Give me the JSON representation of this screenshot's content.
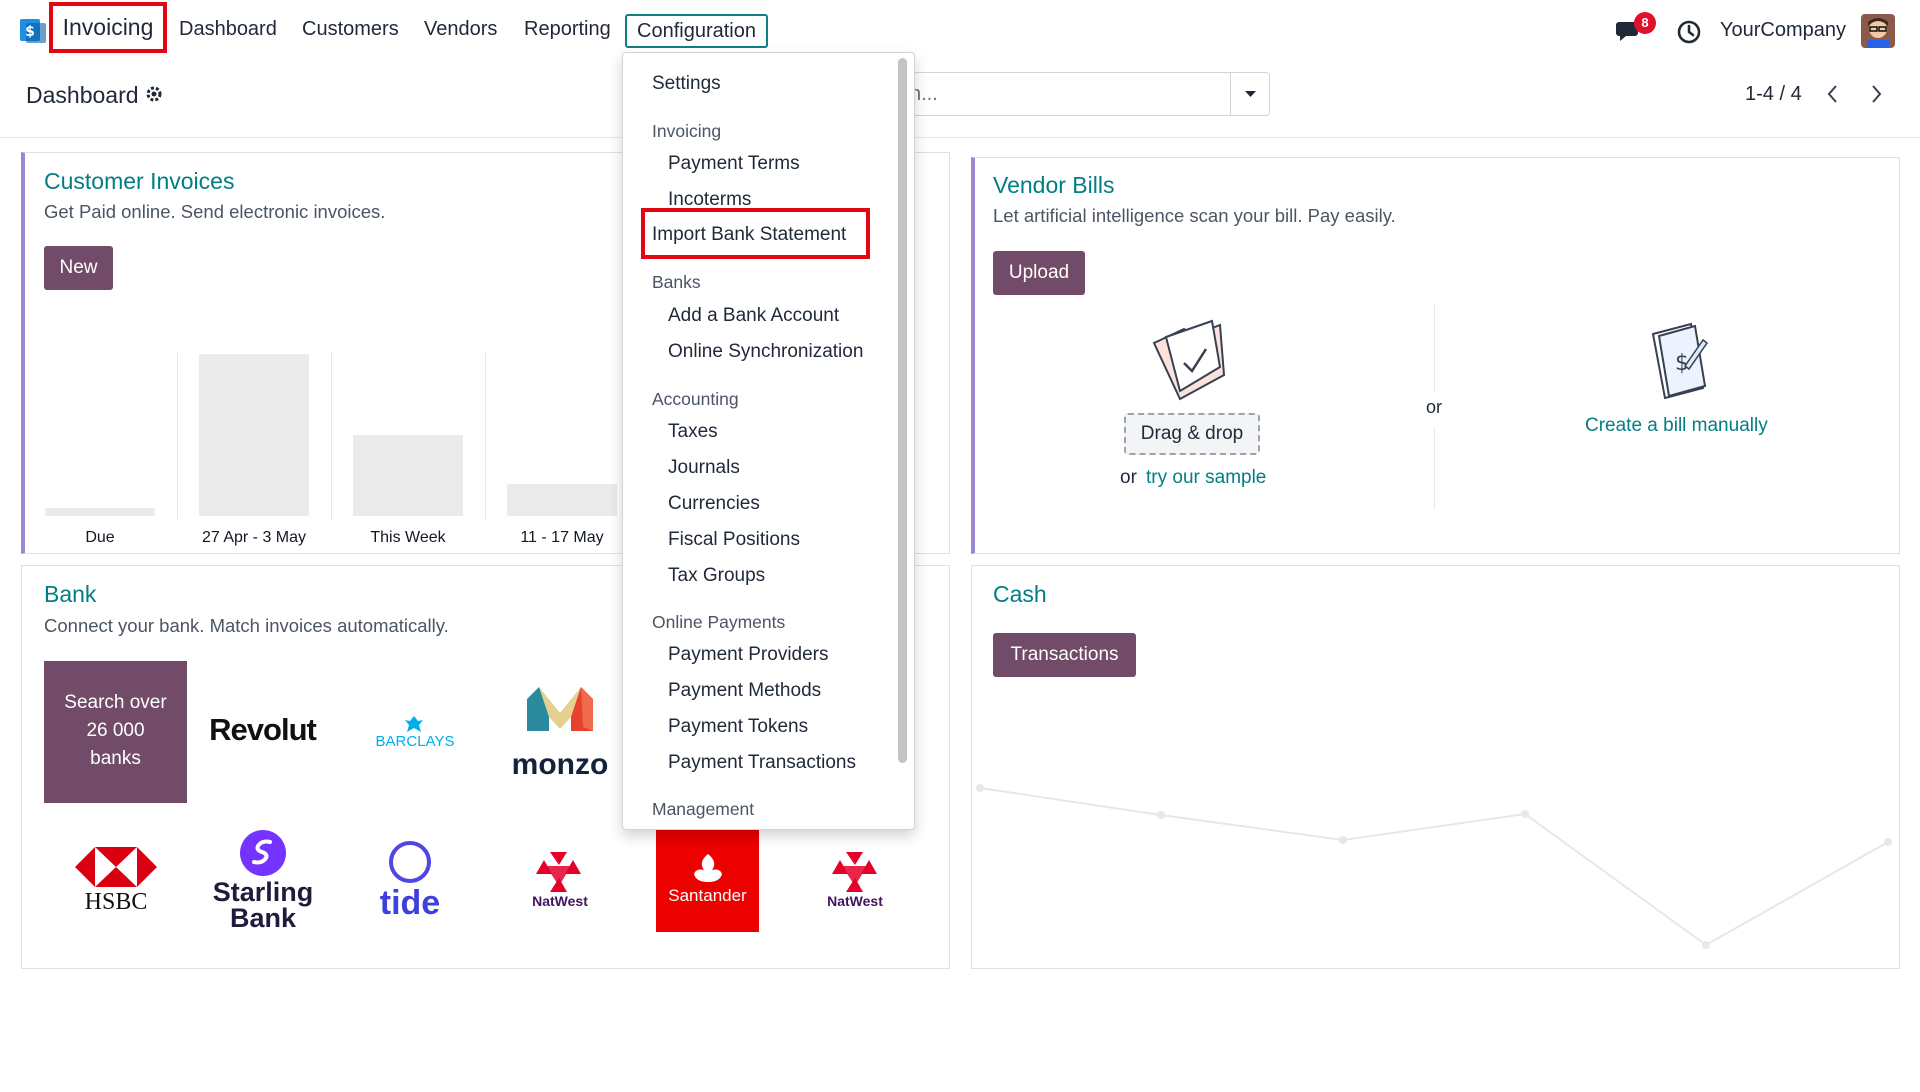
{
  "navbar": {
    "brand": "Invoicing",
    "menus": [
      "Dashboard",
      "Customers",
      "Vendors",
      "Reporting"
    ],
    "config_label": "Configuration",
    "notification_count": "8",
    "company": "YourCompany"
  },
  "control_panel": {
    "title": "Dashboard",
    "search_placeholder": "h...",
    "pager": "1-4 / 4"
  },
  "customer_invoices": {
    "title": "Customer Invoices",
    "subtitle": "Get Paid online. Send electronic invoices.",
    "new_label": "New",
    "chart_labels": [
      "Due",
      "27 Apr - 3 May",
      "This Week",
      "11 - 17 May"
    ]
  },
  "chart_data": {
    "type": "bar",
    "categories": [
      "Due",
      "27 Apr - 3 May",
      "This Week",
      "11 - 17 May"
    ],
    "values": [
      5,
      100,
      50,
      20
    ],
    "title": "",
    "xlabel": "",
    "ylabel": ""
  },
  "vendor_bills": {
    "title": "Vendor Bills",
    "subtitle": "Let artificial intelligence scan your bill. Pay easily.",
    "upload_label": "Upload",
    "drag_drop_label": "Drag & drop",
    "or_label": "or",
    "try_sample_prefix": "or",
    "try_sample_link": "try our sample",
    "create_manual_label": "Create a bill manually"
  },
  "bank": {
    "title": "Bank",
    "subtitle": "Connect your bank. Match invoices automatically.",
    "search_label_1": "Search over",
    "search_label_2": "26 000",
    "search_label_3": "banks",
    "logos": {
      "revolut": "Revolut",
      "barclays": "BARCLAYS",
      "monzo": "monzo",
      "hsbc": "HSBC",
      "starling_1": "Starling",
      "starling_2": "Bank",
      "tide": "tide",
      "natwest": "NatWest",
      "santander": "Santander"
    }
  },
  "cash": {
    "title": "Cash",
    "transactions_label": "Transactions"
  },
  "dropdown": {
    "settings": "Settings",
    "invoicing_header": "Invoicing",
    "payment_terms": "Payment Terms",
    "incoterms": "Incoterms",
    "import_bank_statement": "Import Bank Statement",
    "banks_header": "Banks",
    "add_bank_account": "Add a Bank Account",
    "online_sync": "Online Synchronization",
    "accounting_header": "Accounting",
    "taxes": "Taxes",
    "journals": "Journals",
    "currencies": "Currencies",
    "fiscal_positions": "Fiscal Positions",
    "tax_groups": "Tax Groups",
    "online_payments_header": "Online Payments",
    "payment_providers": "Payment Providers",
    "payment_methods": "Payment Methods",
    "payment_tokens": "Payment Tokens",
    "payment_transactions": "Payment Transactions",
    "management_header": "Management"
  },
  "colors": {
    "brand": "#714b67",
    "accent_teal": "#017e84",
    "highlight_red": "#e30613",
    "badge_red": "#e0112b"
  }
}
